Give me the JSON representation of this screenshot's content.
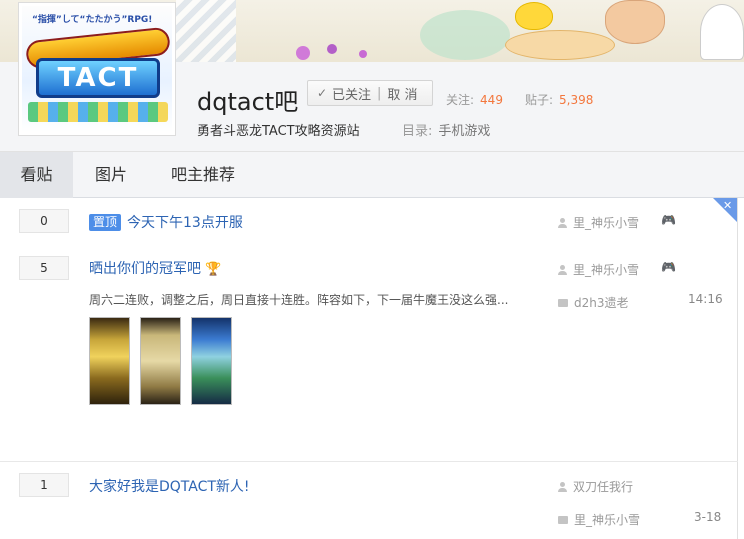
{
  "banner": {
    "logo_tagline": "“指揮”して“たたかう”RPG!",
    "logo_title": "DRAGON QUEST",
    "logo_subtitle": "TACT"
  },
  "forum": {
    "name": "dqtact吧",
    "follow_label": "已关注",
    "unfollow_label": "取 消",
    "followers_label": "关注:",
    "followers_count": "449",
    "posts_label": "贴子:",
    "posts_count": "5,398",
    "slogan": "勇者斗恶龙TACT攻略资源站",
    "category_label": "目录:",
    "category_value": "手机游戏"
  },
  "tabs": [
    {
      "label": "看贴",
      "active": true
    },
    {
      "label": "图片",
      "active": false
    },
    {
      "label": "吧主推荐",
      "active": false
    }
  ],
  "threads": [
    {
      "replies": "0",
      "pinned_label": "置顶",
      "title": "今天下午13点开服",
      "author": "里_神乐小雪",
      "badge": "🎮"
    },
    {
      "replies": "5",
      "title": "晒出你们的冠军吧",
      "trophy": "🏆",
      "author": "里_神乐小雪",
      "badge": "🎮",
      "abstract": "周六二连败，调整之后，周日直接十连胜。阵容如下，下一届牛魔王没这么强...",
      "last_replier": "d2h3遗老",
      "time": "14:16"
    },
    {
      "replies": "1",
      "title": "大家好我是DQTACT新人!",
      "author": "双刀任我行",
      "last_replier": "里_神乐小雪",
      "time": "3-18"
    }
  ],
  "icons": {
    "check": "✓",
    "close": "✕"
  },
  "colors": {
    "accent": "#2d64b3",
    "count": "#f3773d",
    "pinned": "#4d8ee8"
  }
}
